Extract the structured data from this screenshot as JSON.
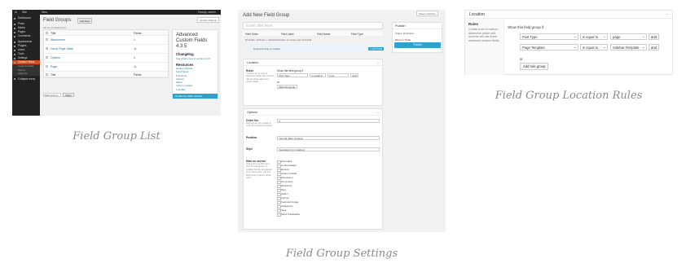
{
  "captions": {
    "list": "Field Group List",
    "settings": "Field Group Settings",
    "location": "Field Group Location Rules"
  },
  "list_screen": {
    "admin_bar": {
      "site": "Site",
      "new": "New",
      "howdy": "Howdy, admin"
    },
    "sidebar": [
      {
        "label": "Dashboard",
        "active": false
      },
      {
        "label": "Posts",
        "active": false
      },
      {
        "label": "Media",
        "active": false
      },
      {
        "label": "Pages",
        "active": false
      },
      {
        "label": "Comments",
        "active": false
      },
      {
        "label": "Appearance",
        "active": false
      },
      {
        "label": "Plugins",
        "active": false
      },
      {
        "label": "Users",
        "active": false
      },
      {
        "label": "Tools",
        "active": false
      },
      {
        "label": "Settings",
        "active": false
      },
      {
        "label": "Custom Fields",
        "active": true
      }
    ],
    "submenu": [
      "Custom Fields",
      "Export",
      "Add-ons"
    ],
    "collapse": "Collapse menu",
    "page_title": "Field Groups",
    "add_new": "Add New",
    "screen_options": "Screen Options",
    "counts": "All (4) | Published (4)",
    "columns": {
      "title": "Title",
      "fields": "Fields"
    },
    "rows": [
      {
        "title": "Attachment",
        "fields": "1"
      },
      {
        "title": "Home Page Slider",
        "fields": "11"
      },
      {
        "title": "Options",
        "fields": "4"
      },
      {
        "title": "Page",
        "fields": "11"
      }
    ],
    "bulk": "Bulk Actions",
    "apply": "Apply",
    "items": "4 items",
    "info": {
      "title": "Advanced Custom Fields 4.3.5",
      "changelog": "Changelog",
      "whats_new": "See what's new in version 4.3.5",
      "resources_title": "Resources",
      "resources": [
        "Getting Started",
        "Field Types",
        "Functions",
        "Actions",
        "Filters",
        "'How to' guides",
        "Tutorials"
      ],
      "footer": "Created by Elliot Condon"
    }
  },
  "settings_screen": {
    "page_title": "Add New Field Group",
    "screen_options": "Screen Options",
    "title_placeholder": "Enter title here",
    "field_columns": [
      "Field Order",
      "Field Label",
      "Field Name",
      "Field Type"
    ],
    "no_fields": "No fields. Click the + Add Field button to create your first field.",
    "drag_hint": "Drag and drop to reorder",
    "add_field": "+ Add Field",
    "publish": {
      "title": "Publish",
      "status": "Status: Draft Edit",
      "trash": "Move to Trash",
      "button": "Publish"
    },
    "location": {
      "title": "Location",
      "rules_label": "Rules",
      "rules_desc": "Create a set of rules to determine which edit screens will use these advanced custom fields",
      "show_if": "Show this field group if",
      "param": "Post Type",
      "operator": "is equal to",
      "value": "post",
      "and": "and",
      "or": "or",
      "add_group": "Add rule group"
    },
    "options": {
      "title": "Options",
      "order_label": "Order No.",
      "order_desc": "Field groups are created in order from lowest to highest",
      "order_value": "0",
      "position_label": "Position",
      "position_value": "Normal (after content)",
      "style_label": "Style",
      "style_value": "Seamless (no metabox)",
      "hide_label": "Hide on screen",
      "hide_desc": "Select items to hide them from the edit screen. If multiple field groups appear on an edit screen, the first field group's options will be used.",
      "hide_items": [
        "Permalink",
        "Content Editor",
        "Excerpt",
        "Custom Fields",
        "Discussion",
        "Comments",
        "Revisions",
        "Slug",
        "Author",
        "Format",
        "Featured Image",
        "Categories",
        "Tags",
        "Send Trackbacks"
      ]
    }
  },
  "location_screen": {
    "title": "Location",
    "rules_title": "Rules",
    "rules_desc": "Create a set of rules to determine which edit screens will use these advanced custom fields",
    "show_if": "Show this field group if",
    "rules": [
      {
        "param": "Post Type",
        "operator": "is equal to",
        "value": "page",
        "and": "and"
      },
      {
        "param": "Page Template",
        "operator": "is equal to",
        "value": "Sidebar Template",
        "and": "and"
      }
    ],
    "or": "or",
    "add_group": "Add rule group"
  },
  "colors": {
    "wp_dark": "#222222",
    "acf_blue": "#2ea2cc",
    "active_menu": "#d54e21",
    "link": "#21759b",
    "caption": "#8a8a8a"
  }
}
